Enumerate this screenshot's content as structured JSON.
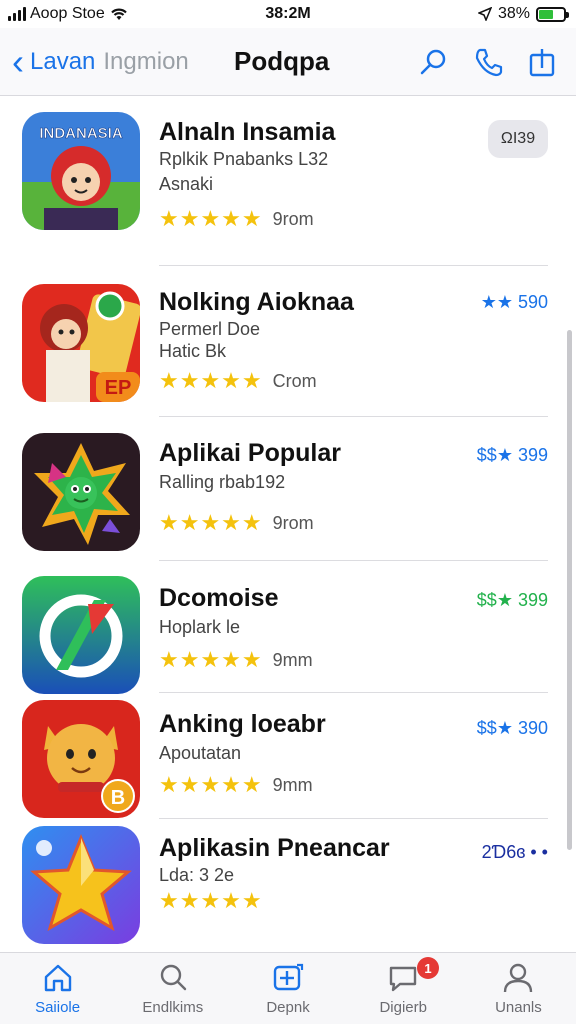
{
  "status_bar": {
    "carrier": "Aoop Stoe",
    "time": "38:2M",
    "battery": "38%"
  },
  "nav": {
    "back_label": "Lavan",
    "back_sub": "Ingmion",
    "title": "Podqpa",
    "actions": [
      "search-icon",
      "phone-icon",
      "share-icon"
    ]
  },
  "apps": [
    {
      "name": "Alnaln Insamia",
      "sub1": "Rplkik Pnabanks L32",
      "sub2": "Asnaki",
      "stars": "★★★★★",
      "count": "9rom",
      "price": "ΩΙ39",
      "price_style": "pill",
      "icon_text": "INDANASIA"
    },
    {
      "name": "Nolking Aioknaa",
      "sub1": "Permerl Doe",
      "sub2": "Ηatic Bk",
      "stars": "★★★★★",
      "count": "Crom",
      "price": "★★ 590",
      "price_style": "blue",
      "icon_text": "EP"
    },
    {
      "name": "Aplikai Popular",
      "sub1": "Ralling rbab192",
      "stars": "★★★★★",
      "count": "9rom",
      "price": "$$★ 399",
      "price_style": "blue"
    },
    {
      "name": "Dcomoise",
      "sub1": "Hoplark le",
      "stars": "★★★★★",
      "count": "9mm",
      "price": "$$★ 399",
      "price_style": "green"
    },
    {
      "name": "Anking loeabr",
      "sub1": "Apoutatan",
      "stars": "★★★★★",
      "count": "9mm",
      "price": "$$★ 390",
      "price_style": "blue",
      "icon_text": "B"
    },
    {
      "name": "Aplikasin Pneancar",
      "sub1": "Lda: 3 2e",
      "stars": "★★★★★",
      "price": "2Ɗ6ɞ • •",
      "price_style": "navy"
    }
  ],
  "tabs": [
    {
      "label": "Saiiole",
      "icon": "home-icon",
      "active": true
    },
    {
      "label": "Endlkims",
      "icon": "search-icon",
      "active": false
    },
    {
      "label": "Depnk",
      "icon": "add-icon",
      "active": false
    },
    {
      "label": "Digierb",
      "icon": "chat-icon",
      "active": false,
      "badge": "1"
    },
    {
      "label": "Unanls",
      "icon": "profile-icon",
      "active": false
    }
  ]
}
